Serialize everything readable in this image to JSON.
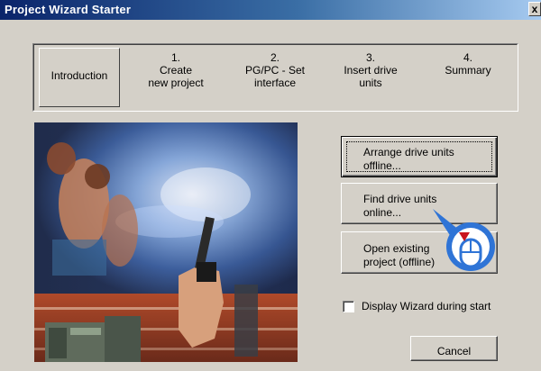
{
  "window": {
    "title": "Project Wizard Starter",
    "close_label": "x"
  },
  "steps": [
    {
      "num": "",
      "label": "Introduction",
      "active": true
    },
    {
      "num": "1.",
      "label": "Create\nnew project",
      "active": false
    },
    {
      "num": "2.",
      "label": "PG/PC - Set\ninterface",
      "active": false
    },
    {
      "num": "3.",
      "label": "Insert drive\nunits",
      "active": false
    },
    {
      "num": "4.",
      "label": "Summary",
      "active": false
    }
  ],
  "buttons": {
    "arrange": "Arrange drive units\noffline...",
    "find": "Find drive units\nonline...",
    "open": "Open existing\nproject (offline)",
    "cancel": "Cancel"
  },
  "checkbox": {
    "label": "Display Wizard during start",
    "checked": false
  },
  "colors": {
    "titlebar_start": "#0a246a",
    "titlebar_end": "#a6caf0",
    "dialog_bg": "#d4d0c8",
    "cursor_ring": "#2f74d6",
    "cursor_arrow": "#c8141e"
  },
  "icons": {
    "cursor": "mouse-click-icon",
    "close": "close-icon"
  }
}
